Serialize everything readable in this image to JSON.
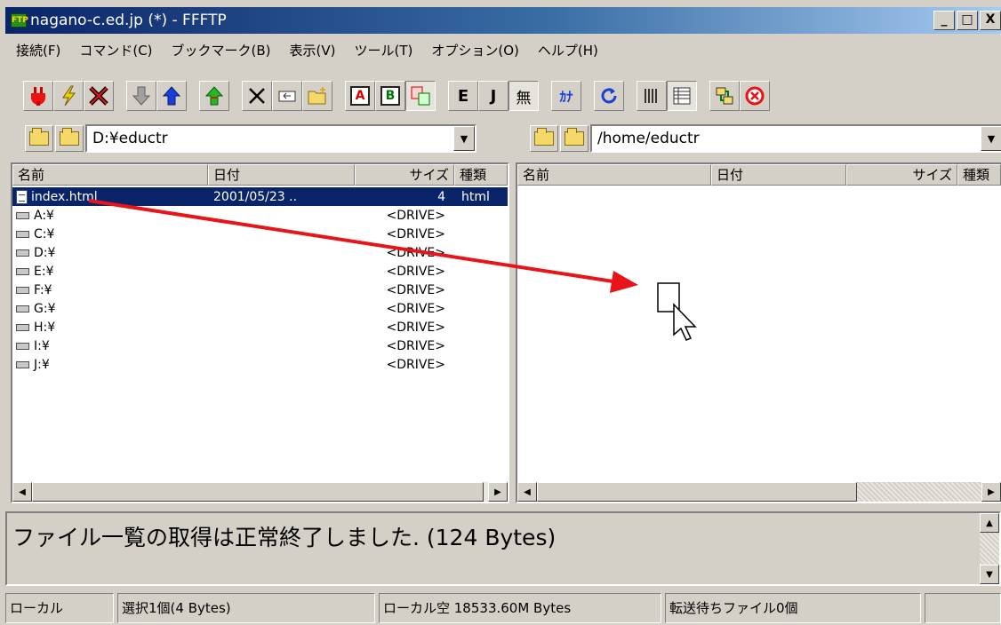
{
  "window": {
    "title": "nagano-c.ed.jp (*) - FFFTP",
    "app_icon": "FTP",
    "buttons": {
      "minimize": "_",
      "maximize": "□",
      "close": "X"
    }
  },
  "menu": [
    "接続(F)",
    "コマンド(C)",
    "ブックマーク(B)",
    "表示(V)",
    "ツール(T)",
    "オプション(O)",
    "ヘルプ(H)"
  ],
  "toolbar": {
    "icons": [
      "connect-icon",
      "quick-connect-icon",
      "disconnect-icon",
      "download-icon",
      "upload-icon",
      "mirror-upload-icon",
      "delete-icon",
      "rename-icon",
      "mkdir-icon",
      "transfer-ascii-icon",
      "transfer-binary-icon",
      "transfer-auto-icon",
      "euc-icon",
      "jis-icon",
      "no-convert-icon",
      "kana-convert-icon",
      "refresh-icon",
      "list-view-icon",
      "detail-view-icon",
      "sync-folder-icon",
      "stop-icon"
    ],
    "ascii": "A",
    "binary": "B",
    "euc": "E",
    "jis": "J",
    "no_convert": "無",
    "kana": "ｶﾅ"
  },
  "local": {
    "path": "D:¥eductr",
    "columns": [
      "名前",
      "日付",
      "サイズ",
      "種類"
    ],
    "rows": [
      {
        "name": "index.html",
        "date": "2001/05/23 ..",
        "size": "4",
        "type": "html",
        "selected": true,
        "kind": "file"
      },
      {
        "name": "A:¥",
        "date": "",
        "size": "<DRIVE>",
        "type": "",
        "kind": "drive"
      },
      {
        "name": "C:¥",
        "date": "",
        "size": "<DRIVE>",
        "type": "",
        "kind": "drive"
      },
      {
        "name": "D:¥",
        "date": "",
        "size": "<DRIVE>",
        "type": "",
        "kind": "drive"
      },
      {
        "name": "E:¥",
        "date": "",
        "size": "<DRIVE>",
        "type": "",
        "kind": "drive"
      },
      {
        "name": "F:¥",
        "date": "",
        "size": "<DRIVE>",
        "type": "",
        "kind": "drive"
      },
      {
        "name": "G:¥",
        "date": "",
        "size": "<DRIVE>",
        "type": "",
        "kind": "drive"
      },
      {
        "name": "H:¥",
        "date": "",
        "size": "<DRIVE>",
        "type": "",
        "kind": "drive"
      },
      {
        "name": "I:¥",
        "date": "",
        "size": "<DRIVE>",
        "type": "",
        "kind": "drive"
      },
      {
        "name": "J:¥",
        "date": "",
        "size": "<DRIVE>",
        "type": "",
        "kind": "drive"
      }
    ]
  },
  "remote": {
    "path": "/home/eductr",
    "columns": [
      "名前",
      "日付",
      "サイズ",
      "種類"
    ],
    "rows": []
  },
  "log": {
    "message": "ファイル一覧の取得は正常終了しました. (124 Bytes)"
  },
  "status": {
    "side": "ローカル",
    "selection": "選択1個(4 Bytes)",
    "free_space": "ローカル空 18533.60M Bytes",
    "queue": "転送待ちファイル0個"
  },
  "colors": {
    "selection": "#0a246a",
    "arrow": "#e8141a",
    "title_start": "#0a246a",
    "title_end": "#a6caf0"
  }
}
